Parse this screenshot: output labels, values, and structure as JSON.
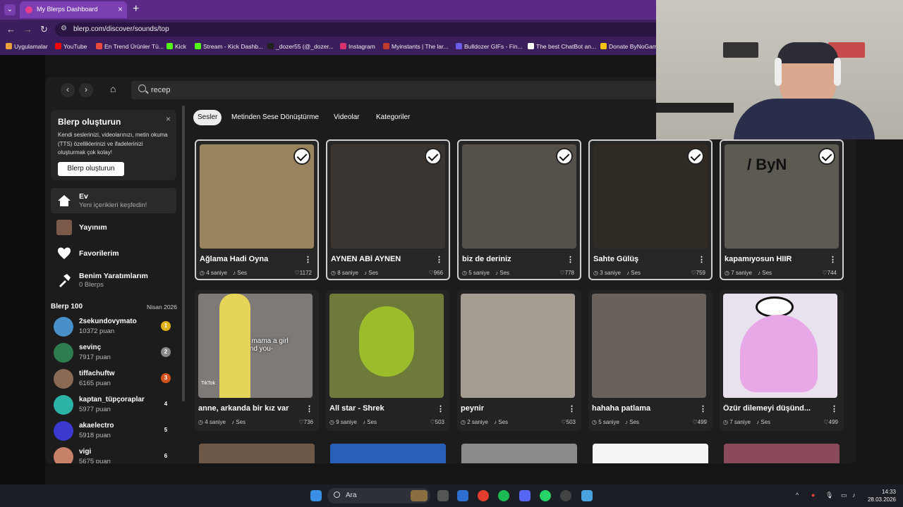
{
  "browser": {
    "tab_title": "My Blerps Dashboard",
    "url": "blerp.com/discover/sounds/top",
    "bookmarks": [
      {
        "label": "Uygulamalar",
        "color": "#e9a23b"
      },
      {
        "label": "YouTube",
        "color": "#ff0000"
      },
      {
        "label": "En Trend Ürünler Tü...",
        "color": "#e84a3c"
      },
      {
        "label": "Kick",
        "color": "#53fc18"
      },
      {
        "label": "Stream - Kick Dashb...",
        "color": "#53fc18"
      },
      {
        "label": "_dozer55 (@_dozer...",
        "color": "#222222"
      },
      {
        "label": "Instagram",
        "color": "#d6336c"
      },
      {
        "label": "Myinstants | The lar...",
        "color": "#c0392b"
      },
      {
        "label": "Bulldozer GIFs - Fin...",
        "color": "#6c5ce7"
      },
      {
        "label": "The best ChatBot an...",
        "color": "#ffffff"
      },
      {
        "label": "Donate ByNoGam",
        "color": "#f1c40f"
      }
    ]
  },
  "search": {
    "value": "recep"
  },
  "sidebar": {
    "create_card": {
      "title": "Blerp oluşturun",
      "description": "Kendi seslerinizi, videolarınızı, metin okuma (TTS) özelliklerinizi ve ifadelerinizi oluşturmak çok kolay!",
      "button": "Blerp oluşturun"
    },
    "nav": [
      {
        "label": "Ev",
        "sub": "Yeni içerikleri keşfedin!"
      },
      {
        "label": "Yayınım",
        "sub": ""
      },
      {
        "label": "Favorilerim",
        "sub": ""
      },
      {
        "label": "Benim Yaratımlarım",
        "sub": "0 Blerps"
      }
    ],
    "leaderboard_title": "Blerp 100",
    "leaderboard_date": "Nisan 2026",
    "leaderboard": [
      {
        "name": "2sekundovymato",
        "points": "10372 puan",
        "rank": "1",
        "badge_color": "#e0b21a",
        "avatar_color": "#4a90c8"
      },
      {
        "name": "sevinç",
        "points": "7917 puan",
        "rank": "2",
        "badge_color": "#8a8a8a",
        "avatar_color": "#2e7d4f"
      },
      {
        "name": "tiffachuftw",
        "points": "6165 puan",
        "rank": "3",
        "badge_color": "#d3541c",
        "avatar_color": "#8a6a55"
      },
      {
        "name": "kaptan_tüpçoraplar",
        "points": "5977 puan",
        "rank": "4",
        "badge_color": "transparent",
        "avatar_color": "#2bb3a6"
      },
      {
        "name": "akaelectro",
        "points": "5918 puan",
        "rank": "5",
        "badge_color": "transparent",
        "avatar_color": "#3a3ad0"
      },
      {
        "name": "vigi",
        "points": "5675 puan",
        "rank": "6",
        "badge_color": "transparent",
        "avatar_color": "#c9826a"
      }
    ]
  },
  "tabs": [
    "Sesler",
    "Metinden Sese Dönüştürme",
    "Videolar",
    "Kategoriler"
  ],
  "meta_type": "Ses",
  "cards": [
    {
      "title": "Ağlama Hadi Oyna",
      "duration": "4 saniye",
      "likes": "1172",
      "selected": true,
      "thumb": "#9a8460"
    },
    {
      "title": "AYNEN ABİ AYNEN",
      "duration": "8 saniye",
      "likes": "966",
      "selected": true,
      "thumb": "#3a3530"
    },
    {
      "title": "biz de deriniz",
      "duration": "5 saniye",
      "likes": "778",
      "selected": true,
      "thumb": "#55504a"
    },
    {
      "title": "Sahte Gülüş",
      "duration": "3 saniye",
      "likes": "759",
      "selected": true,
      "thumb": "#2f2a24"
    },
    {
      "title": "kapamıyosun HIIR",
      "duration": "7 saniye",
      "likes": "744",
      "selected": true,
      "thumb": "#5d5a52"
    },
    {
      "title": "anne, arkanda bir kız var",
      "duration": "4 saniye",
      "likes": "736",
      "selected": false,
      "thumb": "#7d7a78"
    },
    {
      "title": "All star - Shrek",
      "duration": "9 saniye",
      "likes": "503",
      "selected": false,
      "thumb": "#6e7a3a"
    },
    {
      "title": "peynir",
      "duration": "2 saniye",
      "likes": "503",
      "selected": false,
      "thumb": "#a59c92"
    },
    {
      "title": "hahaha patlama",
      "duration": "5 saniye",
      "likes": "499",
      "selected": false,
      "thumb": "#6a625a"
    },
    {
      "title": "Özür dilemeyi düşünd...",
      "duration": "7 saniye",
      "likes": "499",
      "selected": false,
      "thumb": "#e9e2ee"
    }
  ],
  "thumb_captions": {
    "card6": "mommy.. mama a girl behind you-",
    "card6_tag": "TikTok",
    "card5_tag": "/ ByN"
  },
  "taskbar": {
    "search": "Ara",
    "time": "14:33",
    "date": "28.03.2026"
  }
}
